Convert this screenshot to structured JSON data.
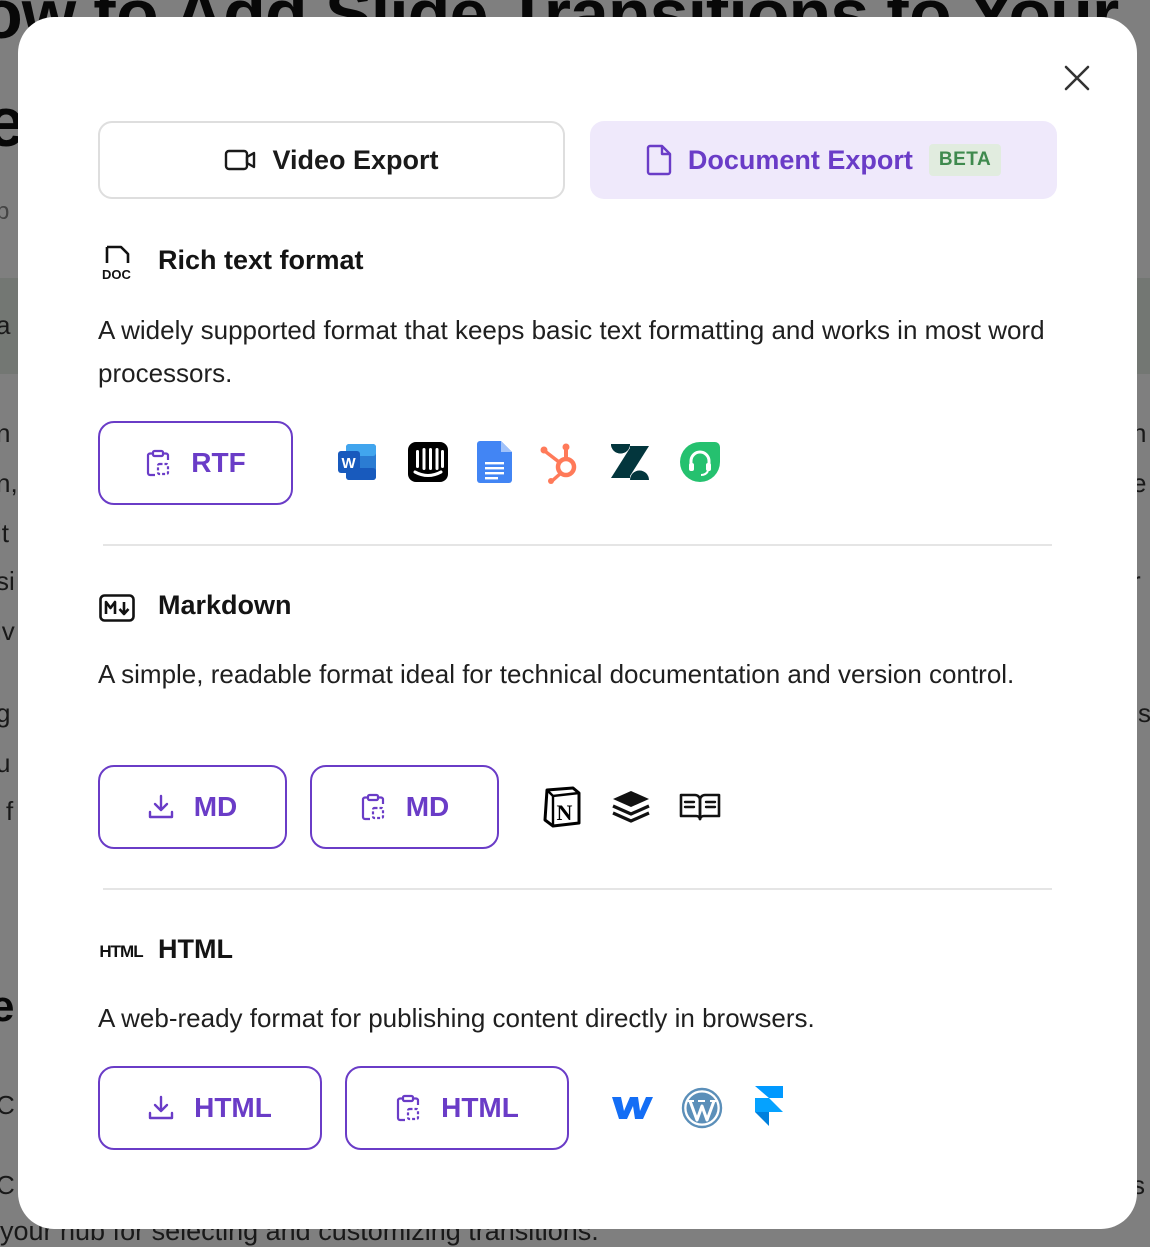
{
  "background": {
    "title_line1": "ow to Add Slide Transitions to Your",
    "title_line2": "e",
    "footer_text": "your hub for selecting and customizing transitions."
  },
  "tabs": {
    "video": {
      "label": "Video Export",
      "icon": "video-camera-icon"
    },
    "document": {
      "label": "Document Export",
      "badge": "BETA",
      "icon": "document-icon"
    }
  },
  "sections": {
    "rtf": {
      "icon": "doc-file-icon",
      "title": "Rich text format",
      "description": "A widely supported format that keeps basic text formatting and works in most word processors.",
      "copy_button": "RTF",
      "apps": [
        "microsoft-word-icon",
        "intercom-icon",
        "google-docs-icon",
        "hubspot-icon",
        "zendesk-icon",
        "freshdesk-icon"
      ]
    },
    "markdown": {
      "icon": "markdown-icon",
      "title": "Markdown",
      "description": "A simple, readable format ideal for technical documentation and version control.",
      "download_button": "MD",
      "copy_button": "MD",
      "apps": [
        "notion-icon",
        "bookstack-icon",
        "readme-icon"
      ]
    },
    "html": {
      "icon_text": "HTML",
      "title": "HTML",
      "description": "A web-ready format for publishing content directly in browsers.",
      "download_button": "HTML",
      "copy_button": "HTML",
      "apps": [
        "webflow-icon",
        "wordpress-icon",
        "framer-icon"
      ]
    }
  },
  "colors": {
    "accent": "#6a3cc7",
    "accent_bg": "#efe9fb",
    "beta_bg": "#e1ecdf",
    "beta_text": "#3f8a4e"
  }
}
